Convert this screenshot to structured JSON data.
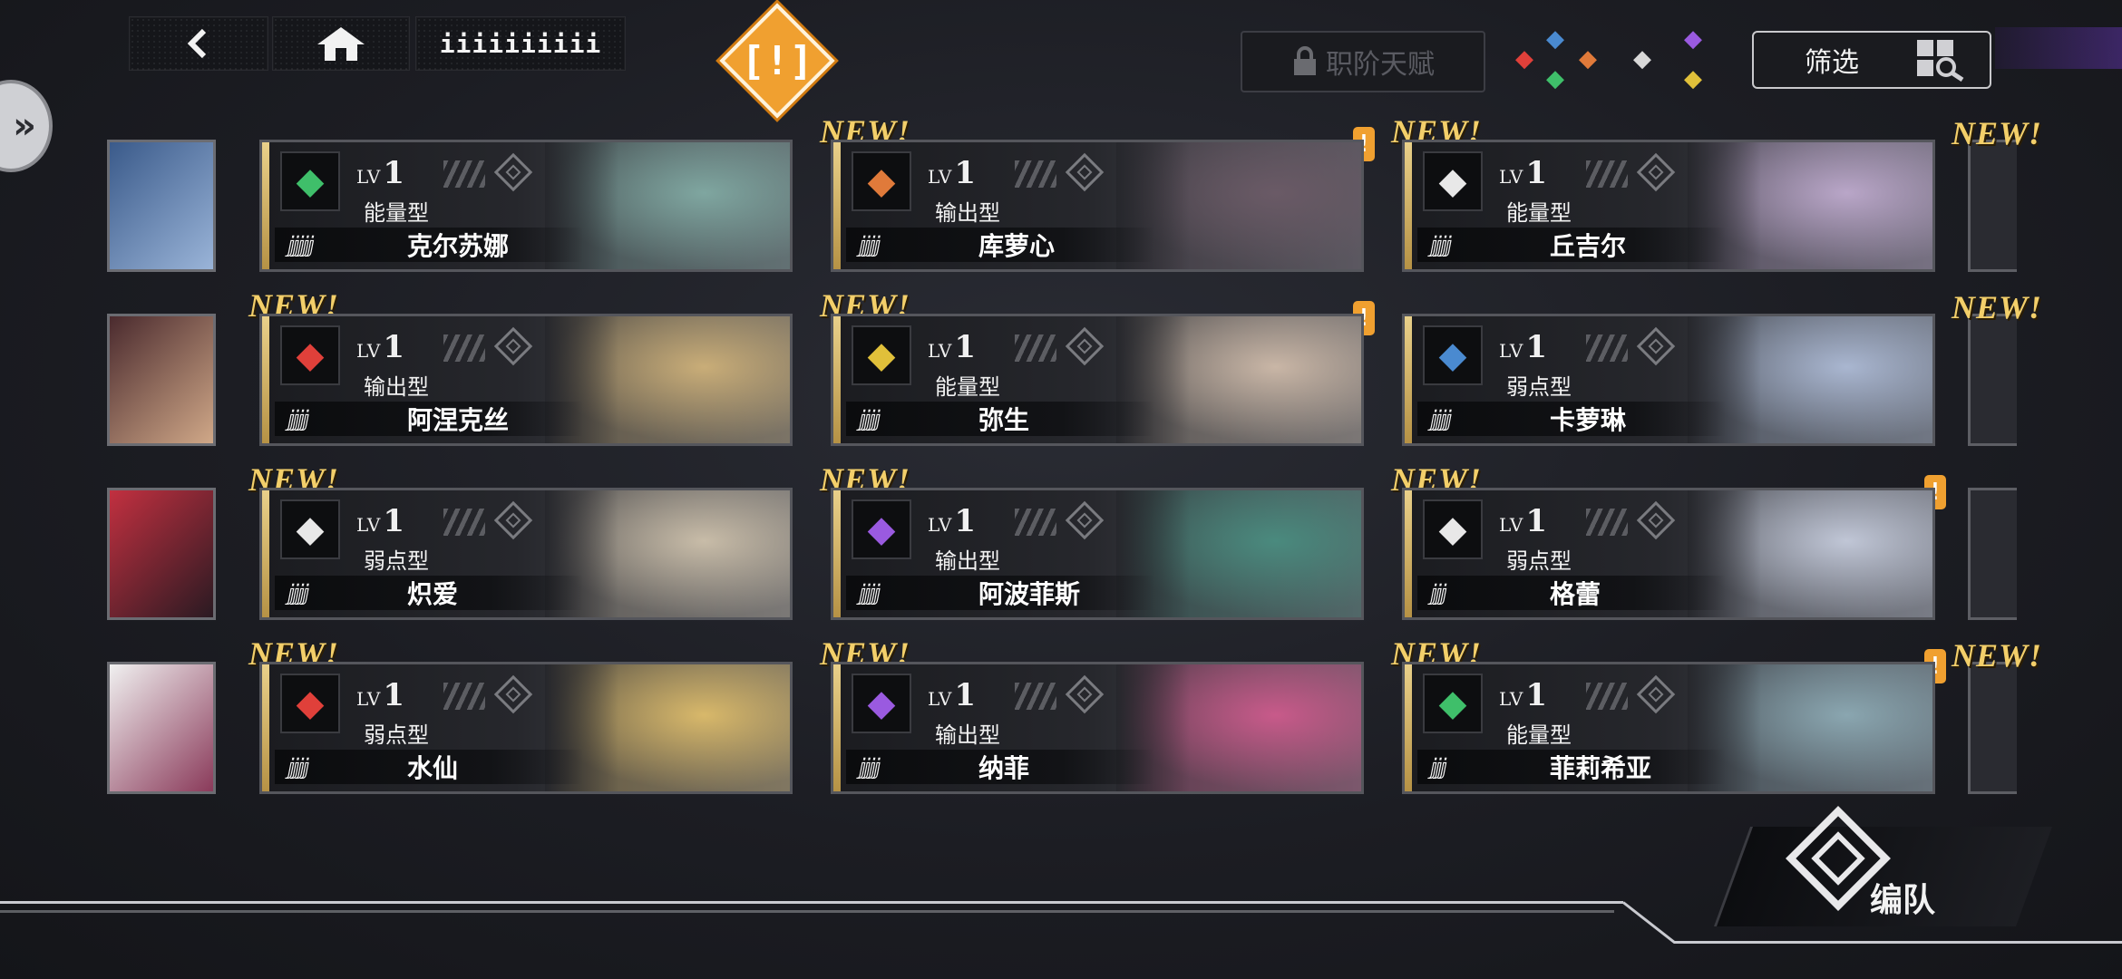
{
  "topbar": {
    "back_icon": "back-arrow-icon",
    "home_icon": "home-icon",
    "title": "iiiiiiiiii",
    "alert_glyph": "[!]"
  },
  "talent_button": {
    "label": "职阶天赋",
    "icon": "lock-icon"
  },
  "filter": {
    "label": "筛选",
    "icon": "filter-search-icon"
  },
  "team_button": {
    "label": "编队"
  },
  "new_label": "NEW!",
  "lv_text": "LV",
  "cards": [
    {
      "name": "克尔苏娜",
      "type": "能量型",
      "level": "1",
      "stars": "ⅉⅉⅉⅉⅉ",
      "element": "green-tree-icon",
      "elem_color": "#3fbf6a",
      "new": false,
      "warn": false,
      "art": "#7fa6a0"
    },
    {
      "name": "库萝心",
      "type": "输出型",
      "level": "1",
      "stars": "ⅉⅉⅉⅉ",
      "element": "ram-horn-icon",
      "elem_color": "#e07a3a",
      "new": true,
      "warn": true,
      "art": "#6a5a66"
    },
    {
      "name": "丘吉尔",
      "type": "能量型",
      "level": "1",
      "stars": "ⅉⅉⅉⅉ",
      "element": "wings-icon",
      "elem_color": "#e8e8e8",
      "new": true,
      "warn": false,
      "art": "#b9a6c8"
    },
    {
      "name": "阿涅克丝",
      "type": "输出型",
      "level": "1",
      "stars": "ⅉⅉⅉⅉ",
      "element": "wolf-icon",
      "elem_color": "#e0403a",
      "new": true,
      "warn": false,
      "art": "#c9ad78"
    },
    {
      "name": "弥生",
      "type": "能量型",
      "level": "1",
      "stars": "ⅉⅉⅉⅉ",
      "element": "chalice-icon",
      "elem_color": "#e0c03a",
      "new": true,
      "warn": true,
      "art": "#c9b6a6"
    },
    {
      "name": "卡萝琳",
      "type": "弱点型",
      "level": "1",
      "stars": "ⅉⅉⅉⅉ",
      "element": "shield-gem-icon",
      "elem_color": "#4a8ad0",
      "new": false,
      "warn": false,
      "art": "#a9b6d0"
    },
    {
      "name": "炽爱",
      "type": "弱点型",
      "level": "1",
      "stars": "ⅉⅉⅉⅉ",
      "element": "wings-icon",
      "elem_color": "#e8e8e8",
      "new": true,
      "warn": false,
      "art": "#c8bca8"
    },
    {
      "name": "阿波菲斯",
      "type": "输出型",
      "level": "1",
      "stars": "ⅉⅉⅉⅉ",
      "element": "crown-icon",
      "elem_color": "#9a5ae0",
      "new": true,
      "warn": false,
      "art": "#4a8a7e"
    },
    {
      "name": "格蕾",
      "type": "弱点型",
      "level": "1",
      "stars": "ⅉⅉⅉ",
      "element": "wings-icon",
      "elem_color": "#e8e8e8",
      "new": true,
      "warn": true,
      "art": "#c0c6d6"
    },
    {
      "name": "水仙",
      "type": "弱点型",
      "level": "1",
      "stars": "ⅉⅉⅉⅉ",
      "element": "wolf-icon",
      "elem_color": "#e0403a",
      "new": true,
      "warn": false,
      "art": "#d8b86a"
    },
    {
      "name": "纳菲",
      "type": "输出型",
      "level": "1",
      "stars": "ⅉⅉⅉⅉ",
      "element": "crown-icon",
      "elem_color": "#9a5ae0",
      "new": true,
      "warn": false,
      "art": "#c85a8a"
    },
    {
      "name": "菲莉希亚",
      "type": "能量型",
      "level": "1",
      "stars": "ⅉⅉⅉ",
      "element": "green-tree-icon",
      "elem_color": "#3fbf6a",
      "new": true,
      "warn": true,
      "art": "#8aa6b0"
    }
  ]
}
